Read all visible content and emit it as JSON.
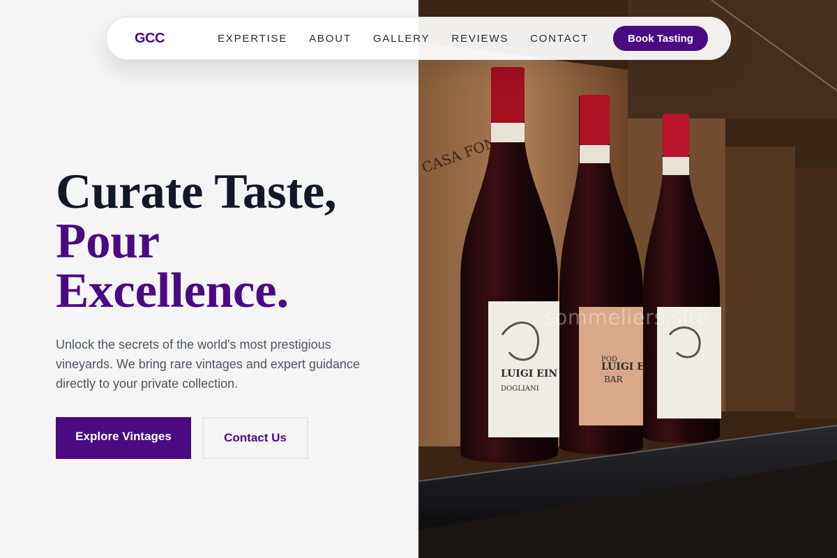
{
  "brand": {
    "logo": "GCC"
  },
  "nav": {
    "links": [
      "EXPERTISE",
      "ABOUT",
      "GALLERY",
      "REVIEWS",
      "CONTACT"
    ],
    "cta": "Book Tasting"
  },
  "hero": {
    "title_line1": "Curate Taste,",
    "title_line2": "Pour",
    "title_line3": "Excellence.",
    "subtitle": "Unlock the secrets of the world's most prestigious vineyards. We bring rare vintages and expert guidance directly to your private collection.",
    "primary_button": "Explore Vintages",
    "secondary_button": "Contact Us"
  },
  "image": {
    "watermark": "sommeliers.site",
    "crate_text": "CASA FON",
    "label_brand": "LUIGI EIN",
    "label_small": "POD",
    "label_sub": "DOGLIANI",
    "label_mid": "BAR"
  },
  "colors": {
    "accent": "#4b0a82",
    "heading": "#111827",
    "body_text": "#4b5563",
    "background": "#f5f5f5"
  }
}
